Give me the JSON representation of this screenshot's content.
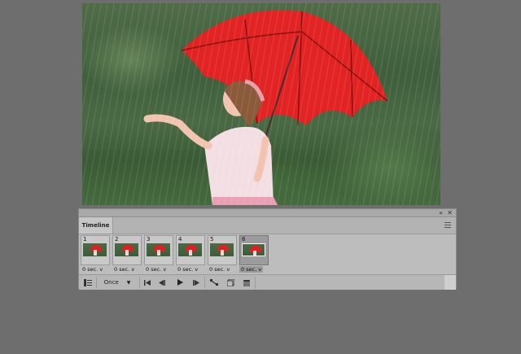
{
  "canvas": {
    "description_icon": "photo-girl-red-umbrella-rain",
    "colors": {
      "umbrella": "#e02020",
      "foliage": "#4f6c47"
    }
  },
  "panel": {
    "collapse_label": "«",
    "close_label": "✕",
    "tab_label": "Timeline",
    "menu_icon": "panel-menu-icon"
  },
  "frames": [
    {
      "number": "1",
      "delay": "0 sec.",
      "selected": false
    },
    {
      "number": "2",
      "delay": "0 sec.",
      "selected": false
    },
    {
      "number": "3",
      "delay": "0 sec.",
      "selected": false
    },
    {
      "number": "4",
      "delay": "0 sec.",
      "selected": false
    },
    {
      "number": "5",
      "delay": "0 sec.",
      "selected": false
    },
    {
      "number": "6",
      "delay": "0 sec.",
      "selected": true
    }
  ],
  "toolbar": {
    "convert_icon": "convert-to-video-timeline-icon",
    "loop_option": "Once",
    "first_frame_icon": "first-frame-icon",
    "prev_frame_icon": "previous-frame-icon",
    "play_icon": "play-icon",
    "next_frame_icon": "next-frame-icon",
    "tween_icon": "tween-icon",
    "duplicate_icon": "duplicate-frame-icon",
    "delete_icon": "delete-frame-icon"
  }
}
